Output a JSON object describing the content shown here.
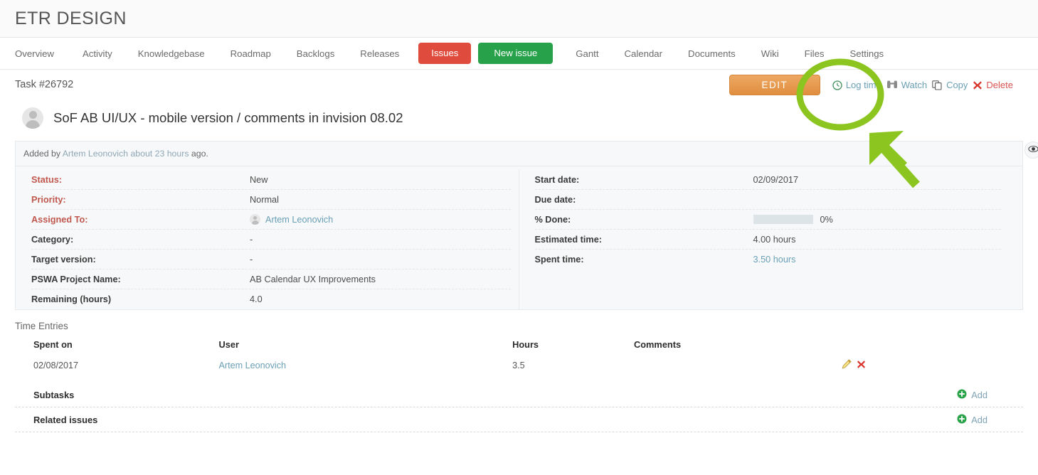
{
  "header": {
    "app_title": "ETR DESIGN"
  },
  "nav": {
    "items": [
      {
        "label": "Overview",
        "name": "overview"
      },
      {
        "label": "Activity",
        "name": "activity"
      },
      {
        "label": "Knowledgebase",
        "name": "knowledgebase"
      },
      {
        "label": "Roadmap",
        "name": "roadmap"
      },
      {
        "label": "Backlogs",
        "name": "backlogs"
      },
      {
        "label": "Releases",
        "name": "releases"
      }
    ],
    "issues_button": "Issues",
    "new_issue_button": "New issue",
    "items_after": [
      {
        "label": "Gantt",
        "name": "gantt"
      },
      {
        "label": "Calendar",
        "name": "calendar"
      },
      {
        "label": "Documents",
        "name": "documents"
      },
      {
        "label": "Wiki",
        "name": "wiki"
      },
      {
        "label": "Files",
        "name": "files"
      },
      {
        "label": "Settings",
        "name": "settings"
      }
    ]
  },
  "task": {
    "id_label": "Task #26792",
    "subject": "SoF AB UI/UX - mobile version / comments in invision 08.02",
    "added_by_prefix": "Added by",
    "added_by_user": "Artem Leonovich",
    "added_by_time": "about 23 hours",
    "added_by_suffix": "ago."
  },
  "actions": {
    "edit": "EDIT",
    "log_time": "Log time",
    "watch": "Watch",
    "copy": "Copy",
    "delete": "Delete"
  },
  "attributes": {
    "left": [
      {
        "label": "Status:",
        "value": "New",
        "required": true
      },
      {
        "label": "Priority:",
        "value": "Normal",
        "required": true
      },
      {
        "label": "Assigned To:",
        "value": "Artem Leonovich",
        "required": true,
        "is_link": true,
        "has_avatar": true
      },
      {
        "label": "Category:",
        "value": "-",
        "required": false
      },
      {
        "label": "Target version:",
        "value": "-",
        "required": false
      },
      {
        "label": "PSWA Project Name:",
        "value": "AB Calendar UX Improvements",
        "required": false
      },
      {
        "label": "Remaining (hours)",
        "value": "4.0",
        "required": false
      }
    ],
    "right": [
      {
        "label": "Start date:",
        "value": "02/09/2017"
      },
      {
        "label": "Due date:",
        "value": ""
      },
      {
        "label": "% Done:",
        "value": "0%",
        "is_progress": true,
        "progress": 0
      },
      {
        "label": "Estimated time:",
        "value": "4.00 hours"
      },
      {
        "label": "Spent time:",
        "value": "3.50 hours",
        "is_link": true
      }
    ]
  },
  "time_entries": {
    "section_title": "Time Entries",
    "columns": [
      "Spent on",
      "User",
      "Hours",
      "Comments"
    ],
    "rows": [
      {
        "spent_on": "02/08/2017",
        "user": "Artem Leonovich",
        "hours": "3.5",
        "comments": ""
      }
    ]
  },
  "bottom_sections": [
    {
      "title": "Subtasks",
      "add_label": "Add"
    },
    {
      "title": "Related issues",
      "add_label": "Add"
    }
  ],
  "icons": {
    "eye": "eye-icon",
    "clock": "clock-icon",
    "binoculars": "binoculars-icon",
    "copy": "copy-icon",
    "cross": "cross-icon",
    "pencil": "pencil-icon",
    "plus": "plus-circle-icon"
  },
  "colors": {
    "issues_red": "#df4b3c",
    "new_issue_green": "#27a24b",
    "edit_orange": "#e08e3e",
    "link_blue": "#6a9fb5",
    "required_red": "#c0584f",
    "delete_red": "#d9534f",
    "annotation_green": "#8cc520",
    "panel_bg": "#f6f8f9"
  },
  "annotation": {
    "shape": "circle-and-arrow",
    "target": "Log time"
  }
}
